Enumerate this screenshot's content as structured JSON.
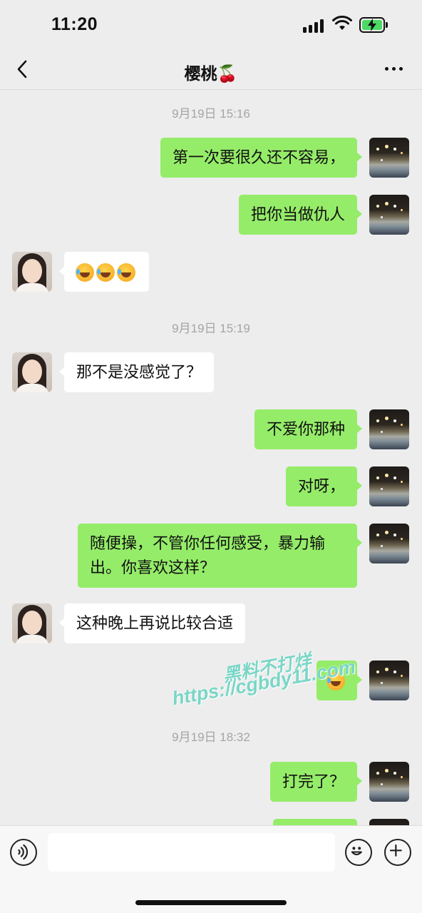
{
  "status_bar": {
    "time": "11:20"
  },
  "nav": {
    "title": "樱桃🍒"
  },
  "messages": [
    {
      "type": "timestamp",
      "text": "9月19日 15:16"
    },
    {
      "type": "mine",
      "text": "第一次要很久还不容易，"
    },
    {
      "type": "mine",
      "text": "把你当做仇人"
    },
    {
      "type": "other",
      "text": "😂😂😂"
    },
    {
      "type": "timestamp",
      "text": "9月19日 15:19"
    },
    {
      "type": "other",
      "text": "那不是没感觉了？"
    },
    {
      "type": "mine",
      "text": "不爱你那种"
    },
    {
      "type": "mine",
      "text": "对呀，"
    },
    {
      "type": "mine",
      "text": "随便操，不管你任何感受，暴力输出。你喜欢这样？"
    },
    {
      "type": "other",
      "text": "这种晚上再说比较合适"
    },
    {
      "type": "mine",
      "text": "😂"
    },
    {
      "type": "timestamp",
      "text": "9月19日 18:32"
    },
    {
      "type": "mine",
      "text": "打完了？"
    }
  ],
  "watermark": {
    "line1": "黑料不打烊",
    "line2": "https://cgbdy11.com"
  },
  "input": {
    "value": ""
  },
  "icons": {
    "voice": "voice-icon",
    "emoji": "emoji-icon",
    "plus": "plus-icon",
    "back": "back-icon",
    "more": "more-icon"
  },
  "colors": {
    "mine_bubble": "#95ec69",
    "other_bubble": "#ffffff",
    "background": "#ededed",
    "timestamp": "#a5a5a5"
  }
}
